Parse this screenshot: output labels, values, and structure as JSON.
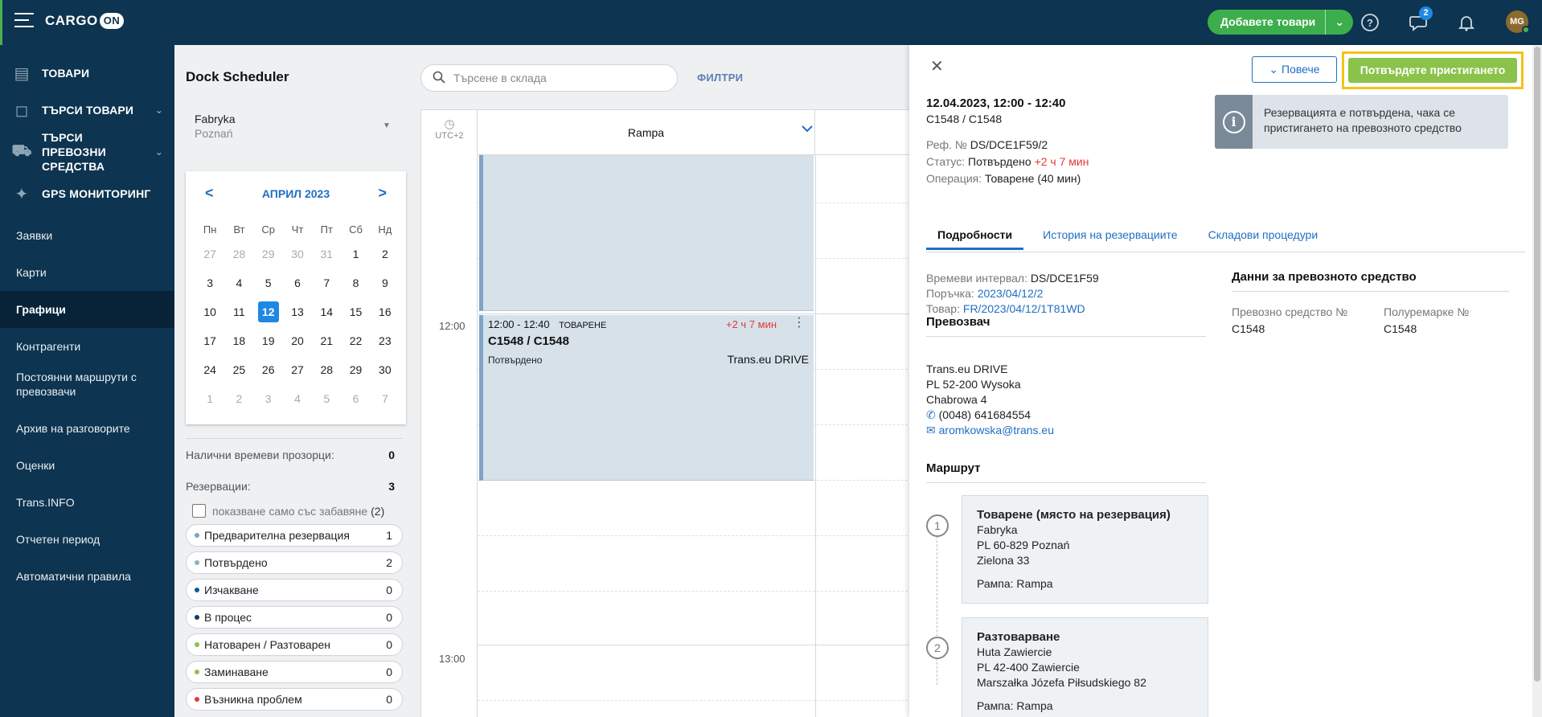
{
  "header": {
    "logo_text": "CARGO",
    "logo_on": "ON",
    "add_goods_label": "Добавете товари",
    "messages_badge": "2",
    "avatar_initials": "MG"
  },
  "sidebar": {
    "main_items": [
      {
        "label": "ТОВАРИ",
        "icon": "box-stack-icon"
      },
      {
        "label": "ТЪРСИ ТОВАРИ",
        "icon": "package-icon"
      },
      {
        "label": "ТЪРСИ ПРЕВОЗНИ СРЕДСТВА",
        "icon": "truck-icon"
      },
      {
        "label": "GPS МОНИТОРИНГ",
        "icon": "satellite-icon"
      }
    ],
    "sub_items": [
      "Заявки",
      "Карти",
      "Графици",
      "Контрагенти",
      "Постоянни маршрути с превозвачи",
      "Архив на разговорите",
      "Оценки",
      "Trans.INFO",
      "Отчетен период",
      "Автоматични правила"
    ]
  },
  "scheduler": {
    "title": "Dock Scheduler",
    "search_placeholder": "Търсене в склада",
    "filters_label": "ФИЛТРИ",
    "facility_name": "Fabryka",
    "facility_city": "Poznań",
    "timezone": "UTC+2",
    "ramp_name": "Rampa",
    "time_12": "12:00",
    "time_13": "13:00"
  },
  "calendar": {
    "month": "АПРИЛ 2023",
    "prev": "<",
    "next": ">",
    "weekdays": [
      "Пн",
      "Вт",
      "Ср",
      "Чт",
      "Пт",
      "Сб",
      "Нд"
    ],
    "days": [
      "27",
      "28",
      "29",
      "30",
      "31",
      "1",
      "2",
      "3",
      "4",
      "5",
      "6",
      "7",
      "8",
      "9",
      "10",
      "11",
      "12",
      "13",
      "14",
      "15",
      "16",
      "17",
      "18",
      "19",
      "20",
      "21",
      "22",
      "23",
      "24",
      "25",
      "26",
      "27",
      "28",
      "29",
      "30",
      "1",
      "2",
      "3",
      "4",
      "5",
      "6",
      "7"
    ],
    "muted_indexes": [
      0,
      1,
      2,
      3,
      4,
      35,
      36,
      37,
      38,
      39,
      40,
      41
    ],
    "today_index": 16
  },
  "stats": {
    "available_label": "Налични времеви прозорци:",
    "available_value": "0",
    "reservations_label": "Резервации:",
    "reservations_value": "3",
    "delay_filter_label": "показване само със забавяне",
    "delay_filter_count": "(2)"
  },
  "legend": [
    {
      "label": "Предварителна резервация",
      "count": "1",
      "color": "#7fa3c2"
    },
    {
      "label": "Потвърдено",
      "count": "2",
      "color": "#8fb0c0"
    },
    {
      "label": "Изчакване",
      "count": "0",
      "color": "#0d5c8c"
    },
    {
      "label": "В процес",
      "count": "0",
      "color": "#0d3f6b"
    },
    {
      "label": "Натоварен / Разтоварен",
      "count": "0",
      "color": "#8bc34a"
    },
    {
      "label": "Заминаване",
      "count": "0",
      "color": "#8bc34a"
    },
    {
      "label": "Възникна проблем",
      "count": "0",
      "color": "#e53935"
    }
  ],
  "booking": {
    "time": "12:00 - 12:40",
    "operation": "ТОВАРЕНЕ",
    "delay": "+2 ч 7 мин",
    "code": "C1548 / C1548",
    "status": "Потвърдено",
    "carrier": "Trans.eu DRIVE"
  },
  "panel": {
    "more_label": "Повече",
    "confirm_label": "Потвърдете пристигането",
    "date": "12.04.2023, 12:00 - 12:40",
    "code": "C1548 / C1548",
    "ref_label": "Реф. №",
    "ref_value": "DS/DCE1F59/2",
    "status_label": "Статус:",
    "status_value": "Потвърдено",
    "status_delay": "+2 ч 7 мин",
    "operation_label": "Операция:",
    "operation_value": "Товарене (40 мин)",
    "info_text": "Резервацията е потвърдена, чака се пристигането на превозното средство",
    "tabs": [
      "Подробности",
      "История на резервациите",
      "Складови процедури"
    ],
    "slot_label": "Времеви интервал:",
    "slot_value": "DS/DCE1F59",
    "order_label": "Поръчка:",
    "order_value": "2023/04/12/2",
    "goods_label": "Товар:",
    "goods_value": "FR/2023/04/12/1T81WD",
    "carrier_title": "Превозвач",
    "carrier_name": "Trans.eu DRIVE",
    "carrier_addr1": "PL 52-200 Wysoka",
    "carrier_addr2": "Chabrowa 4",
    "carrier_phone": "(0048) 641684554",
    "carrier_email": "aromkowska@trans.eu",
    "route_title": "Маршрут",
    "route": [
      {
        "num": "1",
        "title": "Товарене (място на резервация)",
        "l1": "Fabryka",
        "l2": "PL 60-829 Poznań",
        "l3": "Zielona 33",
        "ramp": "Рампа: Rampa"
      },
      {
        "num": "2",
        "title": "Разтоварване",
        "l1": "Huta Zawiercie",
        "l2": "PL 42-400 Zawiercie",
        "l3": "Marszałka Józefa Piłsudskiego 82",
        "ramp": "Рампа: Rampa"
      }
    ],
    "vehicle_title": "Данни за превозното средство",
    "vehicle_no_label": "Превозно средство №",
    "vehicle_no_value": "C1548",
    "trailer_no_label": "Полуремарке №",
    "trailer_no_value": "C1548"
  }
}
